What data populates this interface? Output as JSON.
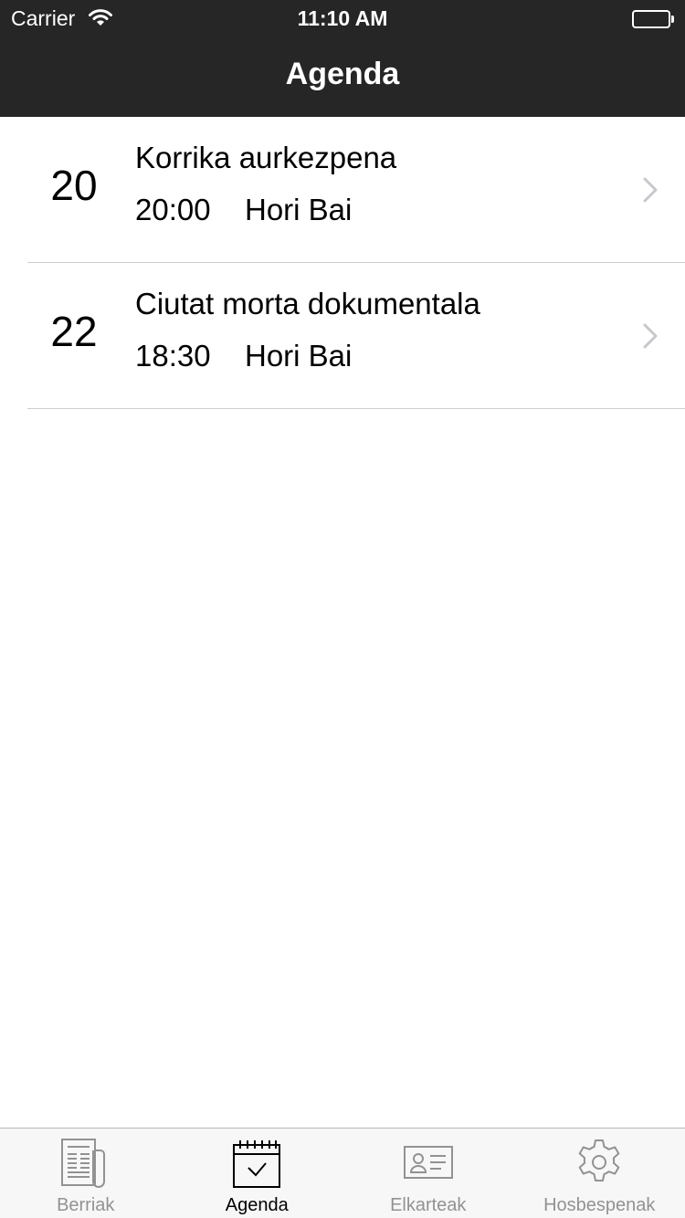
{
  "status_bar": {
    "carrier": "Carrier",
    "time": "11:10 AM",
    "icons": [
      "wifi-icon",
      "battery-icon"
    ]
  },
  "nav": {
    "title": "Agenda"
  },
  "events": [
    {
      "day": "20",
      "title": "Korrika aurkezpena",
      "time": "20:00",
      "place": "Hori Bai"
    },
    {
      "day": "22",
      "title": "Ciutat morta dokumentala",
      "time": "18:30",
      "place": "Hori Bai"
    }
  ],
  "tabs": [
    {
      "label": "Berriak",
      "icon": "newspaper-icon",
      "active": false
    },
    {
      "label": "Agenda",
      "icon": "calendar-icon",
      "active": true
    },
    {
      "label": "Elkarteak",
      "icon": "contact-card-icon",
      "active": false
    },
    {
      "label": "Hosbespenak",
      "icon": "gear-icon",
      "active": false
    }
  ],
  "colors": {
    "nav_background": "#262626",
    "separator": "#cfcfd3",
    "tab_inactive": "#929292",
    "tab_active": "#000000",
    "chevron": "#c7c7cc"
  }
}
